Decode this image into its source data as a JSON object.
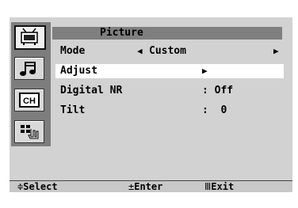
{
  "menu": {
    "title": "Picture",
    "rows": [
      {
        "label": "Mode",
        "value": "Custom",
        "left_arrow": "◀",
        "right_arrow": "▶"
      },
      {
        "label": "Adjust",
        "value": "",
        "right_arrow": "▶"
      },
      {
        "label": "Digital NR",
        "value": ": Off"
      },
      {
        "label": "Tilt",
        "value": ":  0"
      }
    ]
  },
  "icons": [
    "tv-picture-icon",
    "music-note-icon",
    "channel-icon",
    "setup-icon"
  ],
  "channel_icon_text": "CH",
  "help": {
    "select_glyph": "≑",
    "select": "Select",
    "enter_glyph": "±",
    "enter": "Enter",
    "exit_glyph": "Ⅲ",
    "exit": "Exit"
  },
  "colors": {
    "panel": "#d2d2d2",
    "title_bar": "#7f7f7f",
    "icon_column": "#7d7d7d",
    "selected_row": "#ffffff"
  }
}
